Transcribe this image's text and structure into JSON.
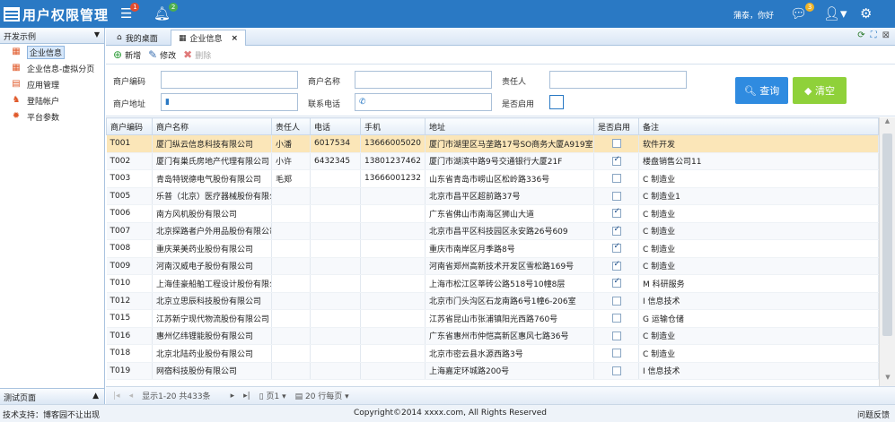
{
  "app": {
    "title": "用户权限管理",
    "menu_badge": "1",
    "bell_badge": "2",
    "chat_badge": "3",
    "greeting": "蒲泰，你好"
  },
  "sidebar": {
    "header": "开发示例",
    "items": [
      {
        "label": "企业信息",
        "icon": "building-icon",
        "color": "#e05a2b"
      },
      {
        "label": "企业信息-虚拟分页",
        "icon": "building-icon",
        "color": "#e05a2b"
      },
      {
        "label": "应用管理",
        "icon": "grid-icon",
        "color": "#e05a2b"
      },
      {
        "label": "登陆帐户",
        "icon": "user-key-icon",
        "color": "#e05a2b"
      },
      {
        "label": "平台参数",
        "icon": "gear-icon",
        "color": "#e05a2b"
      }
    ],
    "footer": "测试页面"
  },
  "tabs": [
    {
      "label": "我的桌面",
      "icon": "home-icon"
    },
    {
      "label": "企业信息",
      "icon": "building-icon"
    }
  ],
  "toolbar": {
    "add": "新增",
    "edit": "修改",
    "delete": "删除"
  },
  "form": {
    "code_label": "商户编码",
    "name_label": "商户名称",
    "owner_label": "责任人",
    "addr_label": "商户地址",
    "phone_label": "联系电话",
    "enabled_label": "是否启用",
    "query": "查询",
    "clear": "清空"
  },
  "grid": {
    "columns": [
      "商户编码",
      "商户名称",
      "责任人",
      "电话",
      "手机",
      "地址",
      "是否启用",
      "备注"
    ],
    "rows": [
      [
        "T001",
        "厦门纵云信息科技有限公司",
        "小潘",
        "6017534",
        "13666005020",
        "厦门市湖里区马垄路17号SO商务大厦A919室",
        false,
        "软件开发"
      ],
      [
        "T002",
        "厦门有巢氏房地产代理有限公司",
        "小许",
        "6432345",
        "13801237462",
        "厦门市湖滨中路9号交通银行大厦21F",
        true,
        "楼盘销售公司11"
      ],
      [
        "T003",
        "青岛特锐德电气股份有限公司",
        "毛郑",
        "",
        "13666001232",
        "山东省青岛市崂山区松岭路336号",
        false,
        "C 制造业"
      ],
      [
        "T005",
        "乐普（北京）医疗器械股份有限公司",
        "",
        "",
        "",
        "北京市昌平区超前路37号",
        false,
        "C 制造业1"
      ],
      [
        "T006",
        "南方风机股份有限公司",
        "",
        "",
        "",
        "广东省佛山市南海区狮山大道",
        true,
        "C 制造业"
      ],
      [
        "T007",
        "北京探路者户外用品股份有限公司",
        "",
        "",
        "",
        "北京市昌平区科技园区永安路26号609",
        true,
        "C 制造业"
      ],
      [
        "T008",
        "重庆莱美药业股份有限公司",
        "",
        "",
        "",
        "重庆市南岸区月季路8号",
        true,
        "C 制造业"
      ],
      [
        "T009",
        "河南汉威电子股份有限公司",
        "",
        "",
        "",
        "河南省郑州高新技术开发区雪松路169号",
        true,
        "C 制造业"
      ],
      [
        "T010",
        "上海佳豪船舶工程设计股份有限公司",
        "",
        "",
        "",
        "上海市松江区莘砖公路518号10幢8层",
        true,
        "M 科研服务"
      ],
      [
        "T012",
        "北京立思辰科技股份有限公司",
        "",
        "",
        "",
        "北京市门头沟区石龙南路6号1幢6-206室",
        false,
        "I 信息技术"
      ],
      [
        "T015",
        "江苏新宁现代物流股份有限公司",
        "",
        "",
        "",
        "江苏省昆山市张浦镇阳光西路760号",
        false,
        "G 运输仓储"
      ],
      [
        "T016",
        "惠州亿纬锂能股份有限公司",
        "",
        "",
        "",
        "广东省惠州市仲恺高新区惠风七路36号",
        false,
        "C 制造业"
      ],
      [
        "T018",
        "北京北陆药业股份有限公司",
        "",
        "",
        "",
        "北京市密云县水源西路3号",
        false,
        "C 制造业"
      ],
      [
        "T019",
        "网宿科技股份有限公司",
        "",
        "",
        "",
        "上海嘉定环城路200号",
        false,
        "I 信息技术"
      ]
    ]
  },
  "pager": {
    "summary": "显示1-20 共433条",
    "page": "页1",
    "size": "20 行每页"
  },
  "status": {
    "left": "技术支持：博客园不让出现",
    "center": "Copyright©2014 xxxx.com, All Rights Reserved",
    "right": "问题反馈"
  }
}
